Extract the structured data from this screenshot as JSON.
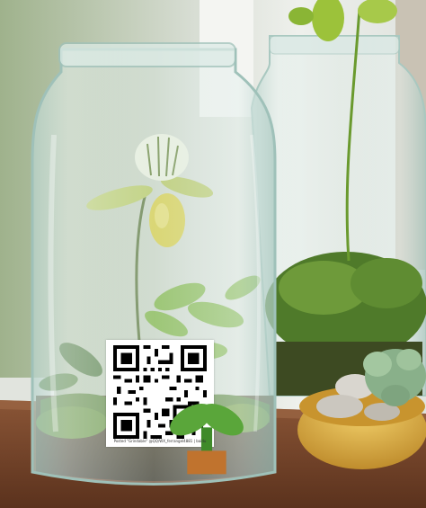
{
  "photo": {
    "subject": "glass jar terrariums with slipper orchid, ferns, moss and succulents on a wooden shelf"
  },
  "qr_overlay": {
    "caption": "Posted \"Grindable\" @QQ/WX_ferrangel4881 | baidu",
    "icon": "plant-logo-icon"
  },
  "colors": {
    "wood": "#7a4a2e",
    "glass": "#cfe3dc",
    "moss": "#4f7a2a",
    "bowl": "#d9a83a",
    "orchid_yellow": "#d9cc3a"
  }
}
